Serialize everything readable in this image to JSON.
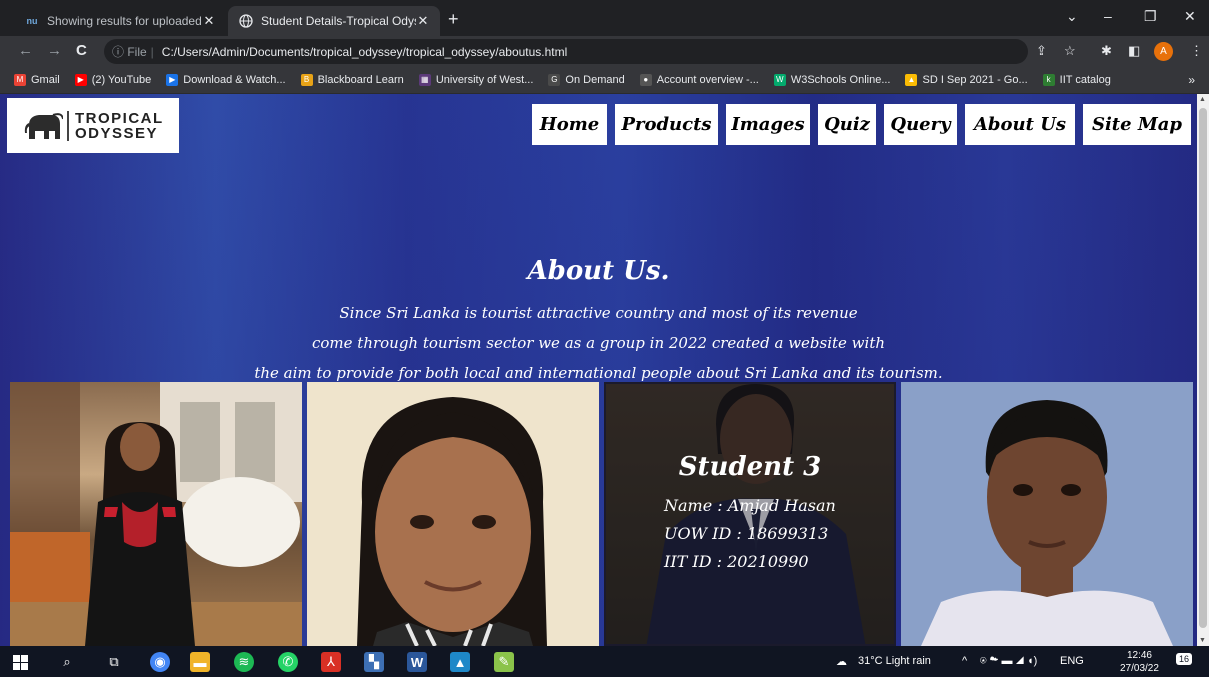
{
  "browser": {
    "tabs": [
      {
        "label": "Showing results for uploaded file",
        "favicon": "nu",
        "active": false
      },
      {
        "label": "Student Details-Tropical Odyssey",
        "favicon": "globe-icon",
        "active": true
      }
    ],
    "address": {
      "info": "ⓘ File",
      "url": "C:/Users/Admin/Documents/tropical_odyssey/tropical_odyssey/aboutus.html"
    },
    "profile_initial": "A",
    "bookmarks": [
      {
        "label": "Gmail",
        "color": "#ea4335",
        "glyph": "M"
      },
      {
        "label": "(2) YouTube",
        "color": "#ff0000",
        "glyph": "▶"
      },
      {
        "label": "Download & Watch...",
        "color": "#1a73e8",
        "glyph": "▶"
      },
      {
        "label": "Blackboard Learn",
        "color": "#e8a317",
        "glyph": "B"
      },
      {
        "label": "University of West...",
        "color": "#5c3a7a",
        "glyph": "▦"
      },
      {
        "label": "On Demand",
        "color": "#4a4a4a",
        "glyph": "G"
      },
      {
        "label": "Account overview -...",
        "color": "#555555",
        "glyph": "●"
      },
      {
        "label": "W3Schools Online...",
        "color": "#04aa6d",
        "glyph": "W"
      },
      {
        "label": "SD I Sep 2021 - Go...",
        "color": "#fbbc04",
        "glyph": "▲"
      },
      {
        "label": "IIT catalog",
        "color": "#2e7d32",
        "glyph": "k"
      }
    ]
  },
  "site": {
    "logo": {
      "line1": "TROPICAL",
      "line2": "ODYSSEY",
      "icon": "elephant-icon"
    },
    "nav": [
      {
        "label": "Home",
        "width": 75
      },
      {
        "label": "Products",
        "width": 103
      },
      {
        "label": "Images",
        "width": 84
      },
      {
        "label": "Quiz",
        "width": 58
      },
      {
        "label": "Query",
        "width": 73
      },
      {
        "label": "About Us",
        "width": 110
      },
      {
        "label": "Site Map",
        "width": 108
      }
    ],
    "about": {
      "heading": "About Us.",
      "lines": [
        "Since Sri Lanka is tourist attractive country and most of its revenue",
        "come through tourism sector we as a group in 2022 created a website with",
        "the aim to provide for both local and international people about Sri Lanka and its tourism."
      ]
    },
    "student3": {
      "title": "Student 3",
      "name": "Name : Amjad Hasan",
      "uow": "UOW ID : 18699313",
      "iit": "IIT ID : 20210990"
    }
  },
  "taskbar": {
    "weather": "31°C  Light rain",
    "lang": "ENG",
    "time": "12:46",
    "date": "27/03/22",
    "notifications": "16"
  }
}
